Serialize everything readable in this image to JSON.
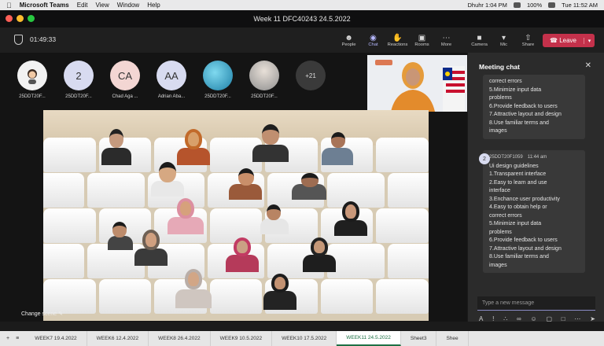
{
  "menubar": {
    "app_name": "Microsoft Teams",
    "menus": [
      "Edit",
      "View",
      "Window",
      "Help"
    ],
    "prayer": "Dhuhr 1:04 PM",
    "battery": "100%",
    "datetime": "Tue 11:52 AM"
  },
  "window": {
    "title": "Week 11 DFC40243 24.5.2022"
  },
  "toolbar": {
    "timer": "01:49:33",
    "buttons": [
      {
        "label": "People",
        "icon": "people-icon"
      },
      {
        "label": "Chat",
        "icon": "chat-icon"
      },
      {
        "label": "Reactions",
        "icon": "reactions-icon"
      },
      {
        "label": "Rooms",
        "icon": "rooms-icon"
      },
      {
        "label": "More",
        "icon": "more-icon"
      }
    ],
    "devices": [
      {
        "label": "Camera",
        "icon": "camera-icon"
      },
      {
        "label": "Mic",
        "icon": "mic-icon"
      },
      {
        "label": "Share",
        "icon": "share-icon"
      }
    ],
    "leave_label": "Leave"
  },
  "participants": [
    {
      "initials": "",
      "name": "25DDT20F...",
      "color": "#f2f2f2"
    },
    {
      "initials": "2",
      "name": "25DDT20F...",
      "color": "#d8dbf0"
    },
    {
      "initials": "CA",
      "name": "Chad Aga ...",
      "color": "#f3d6d3"
    },
    {
      "initials": "AA",
      "name": "Adrian Aba...",
      "color": "#d8dbf0"
    },
    {
      "initials": "",
      "name": "25DDT20F...",
      "color": "#3aa7c9"
    },
    {
      "initials": "",
      "name": "25DDT20F...",
      "color": "#cfcfcf"
    },
    {
      "initials": "+21",
      "name": "",
      "color": "#3a3a3a"
    }
  ],
  "stage": {
    "change_scene": "Change scene"
  },
  "chat": {
    "title": "Meeting chat",
    "message1_lines": [
      "correct errors",
      "5.Minimize input data",
      "problems",
      "6.Provide feedback to users",
      "7.Attractive layout and design",
      "8.Use familiar terms and",
      "images"
    ],
    "message2": {
      "avatar": "2",
      "sender": "25DDT20F1059",
      "time": "11:44 am",
      "lines": [
        "Ui design guidelines",
        "",
        "1.Transparent interface",
        "2.Easy to learn and use",
        "interface",
        "3.Enchance user productivity",
        "4.Easy to obtain help or",
        "correct errors",
        "5.Minimize input data",
        "problems",
        "6.Provide feedback to users",
        "7.Attractive layout and design",
        "8.Use familiar terms and",
        "images"
      ]
    },
    "composer_placeholder": "Type a new message"
  },
  "sheets": {
    "tabs": [
      "WEEK7 19.4.2022",
      "WEEK6 12.4.2022",
      "WEEK8 26.4.2022",
      "WEEK9 10.5.2022",
      "WEEK10 17.5.2022",
      "WEEK11 24.5.2022",
      "Sheet3",
      "Shee"
    ],
    "active_index": 5
  }
}
